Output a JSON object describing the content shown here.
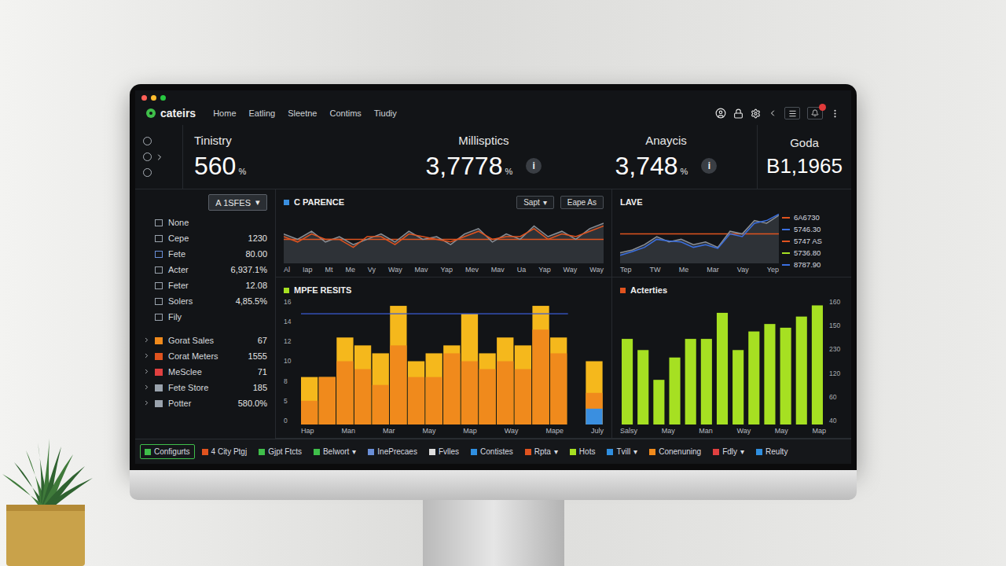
{
  "app": {
    "logo": "cateirs"
  },
  "caret": "▾",
  "nav": [
    {
      "label": "Home",
      "selected": false
    },
    {
      "label": "Eatling",
      "selected": false
    },
    {
      "label": "Sleetne",
      "selected": false
    },
    {
      "label": "Contims",
      "selected": false
    },
    {
      "label": "Tiudiy",
      "selected": false
    }
  ],
  "kpis": [
    {
      "label": "Tinistry",
      "value": "560",
      "unit": "%",
      "info": ""
    },
    {
      "label": "Millisptics",
      "value": "3,7778",
      "unit": "%",
      "info": "i"
    },
    {
      "label": "Anaycis",
      "value": "3,748",
      "unit": "%",
      "info": "i"
    },
    {
      "label": "Goda",
      "value": "B1,1965",
      "unit": "",
      "info": ""
    }
  ],
  "sidebar": {
    "dropdown": "A 1SFES",
    "items": [
      {
        "label": "None",
        "value": "",
        "kind": "plain",
        "color": "#9aa3ad"
      },
      {
        "label": "Cepe",
        "value": "1230",
        "kind": "plain",
        "color": "#9aa3ad"
      },
      {
        "label": "Fete",
        "value": "80.00",
        "kind": "plain",
        "color": "#6a8fd8"
      },
      {
        "label": "Acter",
        "value": "6,937.1%",
        "kind": "plain",
        "color": "#9aa3ad"
      },
      {
        "label": "Feter",
        "value": "12.08",
        "kind": "plain",
        "color": "#9aa3ad"
      },
      {
        "label": "Solers",
        "value": "4,85.5%",
        "kind": "plain",
        "color": "#9aa3ad"
      },
      {
        "label": "Fily",
        "value": "",
        "kind": "plain",
        "color": "#9aa3ad"
      },
      {
        "label": "Gorat Sales",
        "value": "67",
        "kind": "group",
        "color": "#f08a1c"
      },
      {
        "label": "Corat Meters",
        "value": "1555",
        "kind": "group",
        "color": "#e0531f"
      },
      {
        "label": "MeSclee",
        "value": "71",
        "kind": "group",
        "color": "#e04040"
      },
      {
        "label": "Fete Store",
        "value": "185",
        "kind": "group",
        "color": "#9aa3ad"
      },
      {
        "label": "Potter",
        "value": "580.0%",
        "kind": "group",
        "color": "#9aa3ad"
      }
    ]
  },
  "parence": {
    "title": "C PARENCE",
    "controls": [
      {
        "label": "Sapt",
        "dropdown": true
      },
      {
        "label": "Eape As",
        "dropdown": false
      }
    ],
    "series": [
      {
        "color": "#8a8f96",
        "area": true,
        "values": [
          55,
          45,
          60,
          40,
          50,
          35,
          45,
          55,
          40,
          60,
          45,
          50,
          35,
          55,
          65,
          40,
          55,
          45,
          70,
          50,
          60,
          45,
          65,
          75
        ]
      },
      {
        "color": "#e0531f",
        "area": false,
        "values": [
          50,
          40,
          55,
          45,
          45,
          30,
          50,
          50,
          35,
          55,
          50,
          45,
          40,
          50,
          60,
          45,
          50,
          50,
          65,
          45,
          55,
          50,
          60,
          70
        ]
      }
    ],
    "reference": 45,
    "reference_color": "#e0531f",
    "max": 100,
    "x_labels": [
      "Al",
      "Iap",
      "Mt",
      "Me",
      "Vy",
      "Way",
      "Mav",
      "Yap",
      "Mev",
      "Mav",
      "Ua",
      "Yap",
      "Way",
      "Way"
    ]
  },
  "lave": {
    "title": "LAVE",
    "series": [
      {
        "color": "#8a8f96",
        "area": true,
        "values": [
          20,
          25,
          35,
          50,
          40,
          45,
          35,
          40,
          30,
          60,
          55,
          80,
          75,
          90
        ]
      },
      {
        "color": "#3a6fe0",
        "area": false,
        "values": [
          15,
          22,
          30,
          45,
          42,
          40,
          30,
          35,
          28,
          55,
          50,
          75,
          80,
          92
        ]
      }
    ],
    "reference": 55,
    "reference_color": "#e0531f",
    "max": 100,
    "x_labels": [
      "Tep",
      "TW",
      "Me",
      "Mar",
      "Vay",
      "Yep"
    ],
    "legend": [
      {
        "label": "6A6730",
        "color": "#e0531f"
      },
      {
        "label": "5746.30",
        "color": "#3a6fe0"
      },
      {
        "label": "5747 AS",
        "color": "#e0531f"
      },
      {
        "label": "5736.80",
        "color": "#a6e022"
      },
      {
        "label": "8787.90",
        "color": "#3a6fe0"
      }
    ]
  },
  "results": {
    "title": "MPFE RESITS",
    "max": 16,
    "y_ticks": [
      "16",
      "14",
      "12",
      "10",
      "8",
      "5",
      "0"
    ],
    "reference": 14,
    "reference_color": "#3a5bd6",
    "series": [
      {
        "color": "#f5b81c",
        "values": [
          6,
          6,
          11,
          10,
          9,
          15,
          8,
          9,
          10,
          14,
          9,
          11,
          10,
          15,
          11,
          0,
          8
        ]
      },
      {
        "color": "#f08a1c",
        "values": [
          3,
          6,
          8,
          7,
          5,
          10,
          6,
          6,
          9,
          8,
          7,
          8,
          7,
          12,
          9,
          0,
          4
        ]
      },
      {
        "color": "#3a8fe0",
        "values": [
          0,
          0,
          0,
          0,
          0,
          0,
          0,
          0,
          0,
          0,
          0,
          0,
          0,
          0,
          0,
          0,
          2
        ]
      }
    ],
    "x_labels": [
      "Hap",
      "Man",
      "Mar",
      "May",
      "Map",
      "Way",
      "Mape",
      "July"
    ]
  },
  "activities": {
    "title": "Acterties",
    "max": 170,
    "color": "#a6e022",
    "values": [
      115,
      100,
      60,
      90,
      115,
      115,
      150,
      100,
      125,
      135,
      130,
      145,
      160
    ],
    "y_ticks": [
      "160",
      "150",
      "230",
      "120",
      "60",
      "40"
    ],
    "x_labels": [
      "Salsy",
      "May",
      "Man",
      "Way",
      "May",
      "Map"
    ]
  },
  "tabs": [
    {
      "label": "Configurts",
      "selected": true,
      "dropdown": false,
      "color": "#3fbf4a"
    },
    {
      "label": "4 City Ptgj",
      "selected": false,
      "dropdown": false,
      "color": "#e0531f"
    },
    {
      "label": "Gjpt Ftcts",
      "selected": false,
      "dropdown": false,
      "color": "#3fbf4a"
    },
    {
      "label": "Belwort",
      "selected": false,
      "dropdown": true,
      "color": "#3fbf4a"
    },
    {
      "label": "InePrecaes",
      "selected": false,
      "dropdown": false,
      "color": "#6a8fd8"
    },
    {
      "label": "Fvlles",
      "selected": false,
      "dropdown": false,
      "color": "#dddddd"
    },
    {
      "label": "Contistes",
      "selected": false,
      "dropdown": false,
      "color": "#2f8fe0"
    },
    {
      "label": "Rpta",
      "selected": false,
      "dropdown": true,
      "color": "#e0531f"
    },
    {
      "label": "Hots",
      "selected": false,
      "dropdown": false,
      "color": "#a6e022"
    },
    {
      "label": "Tvill",
      "selected": false,
      "dropdown": true,
      "color": "#2f8fe0"
    },
    {
      "label": "Conenuning",
      "selected": false,
      "dropdown": false,
      "color": "#f08a1c"
    },
    {
      "label": "Fdly",
      "selected": false,
      "dropdown": true,
      "color": "#e04040"
    },
    {
      "label": "Reulty",
      "selected": false,
      "dropdown": false,
      "color": "#2f8fe0"
    }
  ]
}
